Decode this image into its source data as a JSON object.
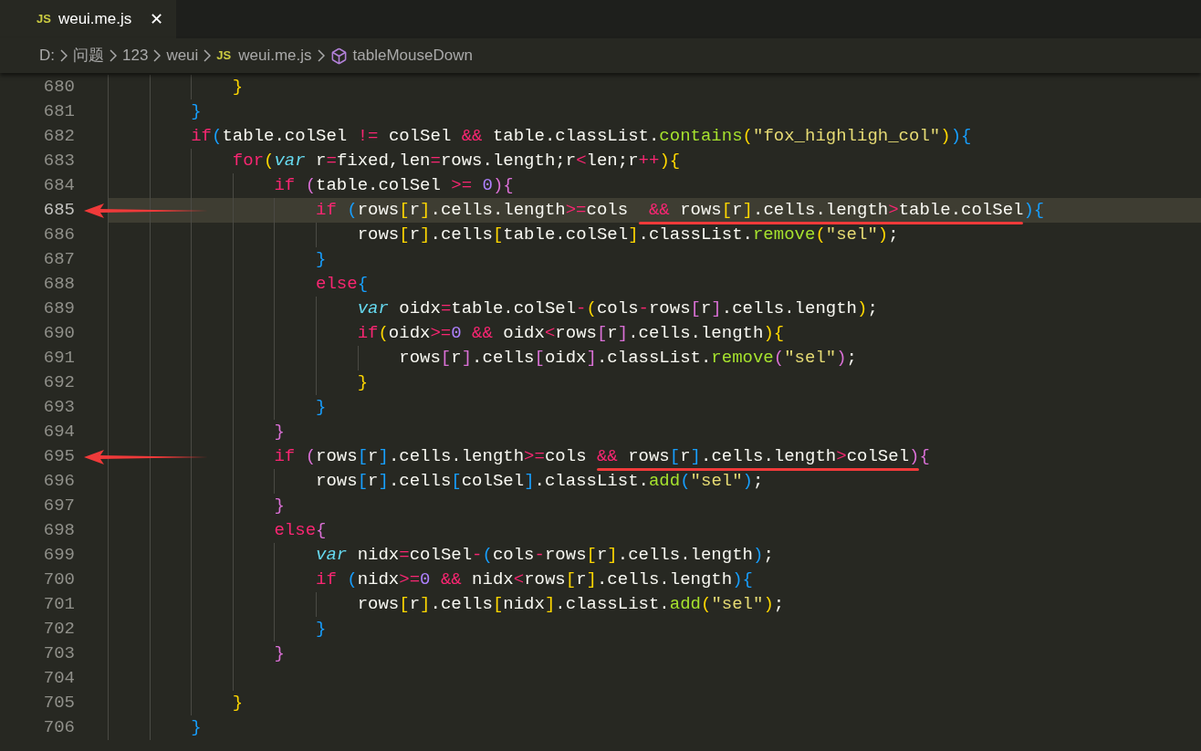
{
  "tabs": [
    {
      "badge": "JS",
      "label": "weui.me.js",
      "selected": true,
      "close": "✕"
    }
  ],
  "breadcrumb": [
    {
      "kind": "folder",
      "label": "D:"
    },
    {
      "kind": "folder",
      "label": "问题"
    },
    {
      "kind": "folder",
      "label": "123"
    },
    {
      "kind": "folder",
      "label": "weui"
    },
    {
      "kind": "file",
      "badge": "JS",
      "label": "weui.me.js"
    },
    {
      "kind": "symbol",
      "label": "tableMouseDown"
    }
  ],
  "lines": [
    {
      "number": "680",
      "highlighted": false,
      "arrow": false,
      "segments": [
        {
          "underlined": false,
          "tokens": [
            {
              "kind": "bracket1",
              "text": "            }"
            }
          ]
        }
      ]
    },
    {
      "number": "681",
      "highlighted": false,
      "arrow": false,
      "segments": [
        {
          "underlined": false,
          "tokens": [
            {
              "kind": "bracket3",
              "text": "        }"
            }
          ]
        }
      ]
    },
    {
      "number": "682",
      "highlighted": false,
      "arrow": false,
      "segments": [
        {
          "underlined": false,
          "tokens": [
            {
              "kind": "keyword",
              "text": "        if"
            },
            {
              "kind": "bracket3",
              "text": "("
            },
            {
              "kind": "text",
              "text": "table.colSel "
            },
            {
              "kind": "operator",
              "text": "!="
            },
            {
              "kind": "text",
              "text": " colSel "
            },
            {
              "kind": "operator",
              "text": "&&"
            },
            {
              "kind": "text",
              "text": " table.classList."
            },
            {
              "kind": "function",
              "text": "contains"
            },
            {
              "kind": "bracket1",
              "text": "("
            },
            {
              "kind": "string",
              "text": "\"fox_highligh_col\""
            },
            {
              "kind": "bracket1",
              "text": ")"
            },
            {
              "kind": "bracket3",
              "text": "){"
            }
          ]
        }
      ]
    },
    {
      "number": "683",
      "highlighted": false,
      "arrow": false,
      "segments": [
        {
          "underlined": false,
          "tokens": [
            {
              "kind": "keyword",
              "text": "            for"
            },
            {
              "kind": "bracket1",
              "text": "("
            },
            {
              "kind": "storage",
              "text": "var"
            },
            {
              "kind": "text",
              "text": " r"
            },
            {
              "kind": "operator",
              "text": "="
            },
            {
              "kind": "text",
              "text": "fixed,len"
            },
            {
              "kind": "operator",
              "text": "="
            },
            {
              "kind": "text",
              "text": "rows.length;r"
            },
            {
              "kind": "operator",
              "text": "<"
            },
            {
              "kind": "text",
              "text": "len;r"
            },
            {
              "kind": "operator",
              "text": "++"
            },
            {
              "kind": "bracket1",
              "text": "){"
            }
          ]
        }
      ]
    },
    {
      "number": "684",
      "highlighted": false,
      "arrow": false,
      "segments": [
        {
          "underlined": false,
          "tokens": [
            {
              "kind": "keyword",
              "text": "                if"
            },
            {
              "kind": "bracket2",
              "text": " ("
            },
            {
              "kind": "text",
              "text": "table.colSel "
            },
            {
              "kind": "operator",
              "text": ">="
            },
            {
              "kind": "number",
              "text": " 0"
            },
            {
              "kind": "bracket2",
              "text": "){"
            }
          ]
        }
      ]
    },
    {
      "number": "685",
      "highlighted": true,
      "arrow": true,
      "segments": [
        {
          "underlined": false,
          "tokens": [
            {
              "kind": "keyword",
              "text": "                    if"
            },
            {
              "kind": "bracket3",
              "text": " ("
            },
            {
              "kind": "text",
              "text": "rows"
            },
            {
              "kind": "bracket1",
              "text": "["
            },
            {
              "kind": "text",
              "text": "r"
            },
            {
              "kind": "bracket1",
              "text": "]"
            },
            {
              "kind": "text",
              "text": ".cells.length"
            },
            {
              "kind": "operator",
              "text": ">="
            },
            {
              "kind": "text",
              "text": "cols "
            }
          ]
        },
        {
          "underlined": true,
          "tokens": [
            {
              "kind": "operator",
              "text": " &&"
            },
            {
              "kind": "text",
              "text": " rows"
            },
            {
              "kind": "bracket1",
              "text": "["
            },
            {
              "kind": "text",
              "text": "r"
            },
            {
              "kind": "bracket1",
              "text": "]"
            },
            {
              "kind": "text",
              "text": ".cells.length"
            },
            {
              "kind": "operator",
              "text": ">"
            },
            {
              "kind": "text",
              "text": "table.colSel"
            }
          ]
        },
        {
          "underlined": false,
          "tokens": [
            {
              "kind": "bracket3",
              "text": "){"
            }
          ]
        }
      ]
    },
    {
      "number": "686",
      "highlighted": false,
      "arrow": false,
      "segments": [
        {
          "underlined": false,
          "tokens": [
            {
              "kind": "text",
              "text": "                        rows"
            },
            {
              "kind": "bracket1",
              "text": "["
            },
            {
              "kind": "text",
              "text": "r"
            },
            {
              "kind": "bracket1",
              "text": "]"
            },
            {
              "kind": "text",
              "text": ".cells"
            },
            {
              "kind": "bracket1",
              "text": "["
            },
            {
              "kind": "text",
              "text": "table.colSel"
            },
            {
              "kind": "bracket1",
              "text": "]"
            },
            {
              "kind": "text",
              "text": ".classList."
            },
            {
              "kind": "function",
              "text": "remove"
            },
            {
              "kind": "bracket1",
              "text": "("
            },
            {
              "kind": "string",
              "text": "\"sel\""
            },
            {
              "kind": "bracket1",
              "text": ")"
            },
            {
              "kind": "text",
              "text": ";"
            }
          ]
        }
      ]
    },
    {
      "number": "687",
      "highlighted": false,
      "arrow": false,
      "segments": [
        {
          "underlined": false,
          "tokens": [
            {
              "kind": "bracket3",
              "text": "                    }"
            }
          ]
        }
      ]
    },
    {
      "number": "688",
      "highlighted": false,
      "arrow": false,
      "segments": [
        {
          "underlined": false,
          "tokens": [
            {
              "kind": "keyword",
              "text": "                    else"
            },
            {
              "kind": "bracket3",
              "text": "{"
            }
          ]
        }
      ]
    },
    {
      "number": "689",
      "highlighted": false,
      "arrow": false,
      "segments": [
        {
          "underlined": false,
          "tokens": [
            {
              "kind": "storage",
              "text": "                        var"
            },
            {
              "kind": "text",
              "text": " oidx"
            },
            {
              "kind": "operator",
              "text": "="
            },
            {
              "kind": "text",
              "text": "table.colSel"
            },
            {
              "kind": "operator",
              "text": "-"
            },
            {
              "kind": "bracket1",
              "text": "("
            },
            {
              "kind": "text",
              "text": "cols"
            },
            {
              "kind": "operator",
              "text": "-"
            },
            {
              "kind": "text",
              "text": "rows"
            },
            {
              "kind": "bracket2",
              "text": "["
            },
            {
              "kind": "text",
              "text": "r"
            },
            {
              "kind": "bracket2",
              "text": "]"
            },
            {
              "kind": "text",
              "text": ".cells.length"
            },
            {
              "kind": "bracket1",
              "text": ")"
            },
            {
              "kind": "text",
              "text": ";"
            }
          ]
        }
      ]
    },
    {
      "number": "690",
      "highlighted": false,
      "arrow": false,
      "segments": [
        {
          "underlined": false,
          "tokens": [
            {
              "kind": "keyword",
              "text": "                        if"
            },
            {
              "kind": "bracket1",
              "text": "("
            },
            {
              "kind": "text",
              "text": "oidx"
            },
            {
              "kind": "operator",
              "text": ">="
            },
            {
              "kind": "number",
              "text": "0"
            },
            {
              "kind": "operator",
              "text": " &&"
            },
            {
              "kind": "text",
              "text": " oidx"
            },
            {
              "kind": "operator",
              "text": "<"
            },
            {
              "kind": "text",
              "text": "rows"
            },
            {
              "kind": "bracket2",
              "text": "["
            },
            {
              "kind": "text",
              "text": "r"
            },
            {
              "kind": "bracket2",
              "text": "]"
            },
            {
              "kind": "text",
              "text": ".cells.length"
            },
            {
              "kind": "bracket1",
              "text": "){"
            }
          ]
        }
      ]
    },
    {
      "number": "691",
      "highlighted": false,
      "arrow": false,
      "segments": [
        {
          "underlined": false,
          "tokens": [
            {
              "kind": "text",
              "text": "                            rows"
            },
            {
              "kind": "bracket2",
              "text": "["
            },
            {
              "kind": "text",
              "text": "r"
            },
            {
              "kind": "bracket2",
              "text": "]"
            },
            {
              "kind": "text",
              "text": ".cells"
            },
            {
              "kind": "bracket2",
              "text": "["
            },
            {
              "kind": "text",
              "text": "oidx"
            },
            {
              "kind": "bracket2",
              "text": "]"
            },
            {
              "kind": "text",
              "text": ".classList."
            },
            {
              "kind": "function",
              "text": "remove"
            },
            {
              "kind": "bracket2",
              "text": "("
            },
            {
              "kind": "string",
              "text": "\"sel\""
            },
            {
              "kind": "bracket2",
              "text": ")"
            },
            {
              "kind": "text",
              "text": ";"
            }
          ]
        }
      ]
    },
    {
      "number": "692",
      "highlighted": false,
      "arrow": false,
      "segments": [
        {
          "underlined": false,
          "tokens": [
            {
              "kind": "bracket1",
              "text": "                        }"
            }
          ]
        }
      ]
    },
    {
      "number": "693",
      "highlighted": false,
      "arrow": false,
      "segments": [
        {
          "underlined": false,
          "tokens": [
            {
              "kind": "bracket3",
              "text": "                    }"
            }
          ]
        }
      ]
    },
    {
      "number": "694",
      "highlighted": false,
      "arrow": false,
      "segments": [
        {
          "underlined": false,
          "tokens": [
            {
              "kind": "bracket2",
              "text": "                }"
            }
          ]
        }
      ]
    },
    {
      "number": "695",
      "highlighted": false,
      "arrow": true,
      "segments": [
        {
          "underlined": false,
          "tokens": [
            {
              "kind": "keyword",
              "text": "                if"
            },
            {
              "kind": "bracket2",
              "text": " ("
            },
            {
              "kind": "text",
              "text": "rows"
            },
            {
              "kind": "bracket3",
              "text": "["
            },
            {
              "kind": "text",
              "text": "r"
            },
            {
              "kind": "bracket3",
              "text": "]"
            },
            {
              "kind": "text",
              "text": ".cells.length"
            },
            {
              "kind": "operator",
              "text": ">="
            },
            {
              "kind": "text",
              "text": "cols "
            }
          ]
        },
        {
          "underlined": true,
          "tokens": [
            {
              "kind": "operator",
              "text": "&&"
            },
            {
              "kind": "text",
              "text": " rows"
            },
            {
              "kind": "bracket3",
              "text": "["
            },
            {
              "kind": "text",
              "text": "r"
            },
            {
              "kind": "bracket3",
              "text": "]"
            },
            {
              "kind": "text",
              "text": ".cells.length"
            },
            {
              "kind": "operator",
              "text": ">"
            },
            {
              "kind": "text",
              "text": "colSel"
            },
            {
              "kind": "bracket2",
              "text": ")"
            }
          ]
        },
        {
          "underlined": false,
          "tokens": [
            {
              "kind": "bracket2",
              "text": "{"
            }
          ]
        }
      ]
    },
    {
      "number": "696",
      "highlighted": false,
      "arrow": false,
      "segments": [
        {
          "underlined": false,
          "tokens": [
            {
              "kind": "text",
              "text": "                    rows"
            },
            {
              "kind": "bracket3",
              "text": "["
            },
            {
              "kind": "text",
              "text": "r"
            },
            {
              "kind": "bracket3",
              "text": "]"
            },
            {
              "kind": "text",
              "text": ".cells"
            },
            {
              "kind": "bracket3",
              "text": "["
            },
            {
              "kind": "text",
              "text": "colSel"
            },
            {
              "kind": "bracket3",
              "text": "]"
            },
            {
              "kind": "text",
              "text": ".classList."
            },
            {
              "kind": "function",
              "text": "add"
            },
            {
              "kind": "bracket3",
              "text": "("
            },
            {
              "kind": "string",
              "text": "\"sel\""
            },
            {
              "kind": "bracket3",
              "text": ")"
            },
            {
              "kind": "text",
              "text": ";"
            }
          ]
        }
      ]
    },
    {
      "number": "697",
      "highlighted": false,
      "arrow": false,
      "segments": [
        {
          "underlined": false,
          "tokens": [
            {
              "kind": "bracket2",
              "text": "                }"
            }
          ]
        }
      ]
    },
    {
      "number": "698",
      "highlighted": false,
      "arrow": false,
      "segments": [
        {
          "underlined": false,
          "tokens": [
            {
              "kind": "keyword",
              "text": "                else"
            },
            {
              "kind": "bracket2",
              "text": "{"
            }
          ]
        }
      ]
    },
    {
      "number": "699",
      "highlighted": false,
      "arrow": false,
      "segments": [
        {
          "underlined": false,
          "tokens": [
            {
              "kind": "storage",
              "text": "                    var"
            },
            {
              "kind": "text",
              "text": " nidx"
            },
            {
              "kind": "operator",
              "text": "="
            },
            {
              "kind": "text",
              "text": "colSel"
            },
            {
              "kind": "operator",
              "text": "-"
            },
            {
              "kind": "bracket3",
              "text": "("
            },
            {
              "kind": "text",
              "text": "cols"
            },
            {
              "kind": "operator",
              "text": "-"
            },
            {
              "kind": "text",
              "text": "rows"
            },
            {
              "kind": "bracket1",
              "text": "["
            },
            {
              "kind": "text",
              "text": "r"
            },
            {
              "kind": "bracket1",
              "text": "]"
            },
            {
              "kind": "text",
              "text": ".cells.length"
            },
            {
              "kind": "bracket3",
              "text": ")"
            },
            {
              "kind": "text",
              "text": ";"
            }
          ]
        }
      ]
    },
    {
      "number": "700",
      "highlighted": false,
      "arrow": false,
      "segments": [
        {
          "underlined": false,
          "tokens": [
            {
              "kind": "keyword",
              "text": "                    if"
            },
            {
              "kind": "bracket3",
              "text": " ("
            },
            {
              "kind": "text",
              "text": "nidx"
            },
            {
              "kind": "operator",
              "text": ">="
            },
            {
              "kind": "number",
              "text": "0"
            },
            {
              "kind": "operator",
              "text": " &&"
            },
            {
              "kind": "text",
              "text": " nidx"
            },
            {
              "kind": "operator",
              "text": "<"
            },
            {
              "kind": "text",
              "text": "rows"
            },
            {
              "kind": "bracket1",
              "text": "["
            },
            {
              "kind": "text",
              "text": "r"
            },
            {
              "kind": "bracket1",
              "text": "]"
            },
            {
              "kind": "text",
              "text": ".cells.length"
            },
            {
              "kind": "bracket3",
              "text": "){"
            }
          ]
        }
      ]
    },
    {
      "number": "701",
      "highlighted": false,
      "arrow": false,
      "segments": [
        {
          "underlined": false,
          "tokens": [
            {
              "kind": "text",
              "text": "                        rows"
            },
            {
              "kind": "bracket1",
              "text": "["
            },
            {
              "kind": "text",
              "text": "r"
            },
            {
              "kind": "bracket1",
              "text": "]"
            },
            {
              "kind": "text",
              "text": ".cells"
            },
            {
              "kind": "bracket1",
              "text": "["
            },
            {
              "kind": "text",
              "text": "nidx"
            },
            {
              "kind": "bracket1",
              "text": "]"
            },
            {
              "kind": "text",
              "text": ".classList."
            },
            {
              "kind": "function",
              "text": "add"
            },
            {
              "kind": "bracket1",
              "text": "("
            },
            {
              "kind": "string",
              "text": "\"sel\""
            },
            {
              "kind": "bracket1",
              "text": ")"
            },
            {
              "kind": "text",
              "text": ";"
            }
          ]
        }
      ]
    },
    {
      "number": "702",
      "highlighted": false,
      "arrow": false,
      "segments": [
        {
          "underlined": false,
          "tokens": [
            {
              "kind": "bracket3",
              "text": "                    }"
            }
          ]
        }
      ]
    },
    {
      "number": "703",
      "highlighted": false,
      "arrow": false,
      "segments": [
        {
          "underlined": false,
          "tokens": [
            {
              "kind": "bracket2",
              "text": "                }"
            }
          ]
        }
      ]
    },
    {
      "number": "704",
      "highlighted": false,
      "arrow": false
    },
    {
      "number": "705",
      "highlighted": false,
      "arrow": false,
      "segments": [
        {
          "underlined": false,
          "tokens": [
            {
              "kind": "bracket1",
              "text": "            }"
            }
          ]
        }
      ]
    },
    {
      "number": "706",
      "highlighted": false,
      "arrow": false,
      "segments": [
        {
          "underlined": false,
          "tokens": [
            {
              "kind": "bracket3",
              "text": "        }"
            }
          ]
        }
      ]
    }
  ]
}
